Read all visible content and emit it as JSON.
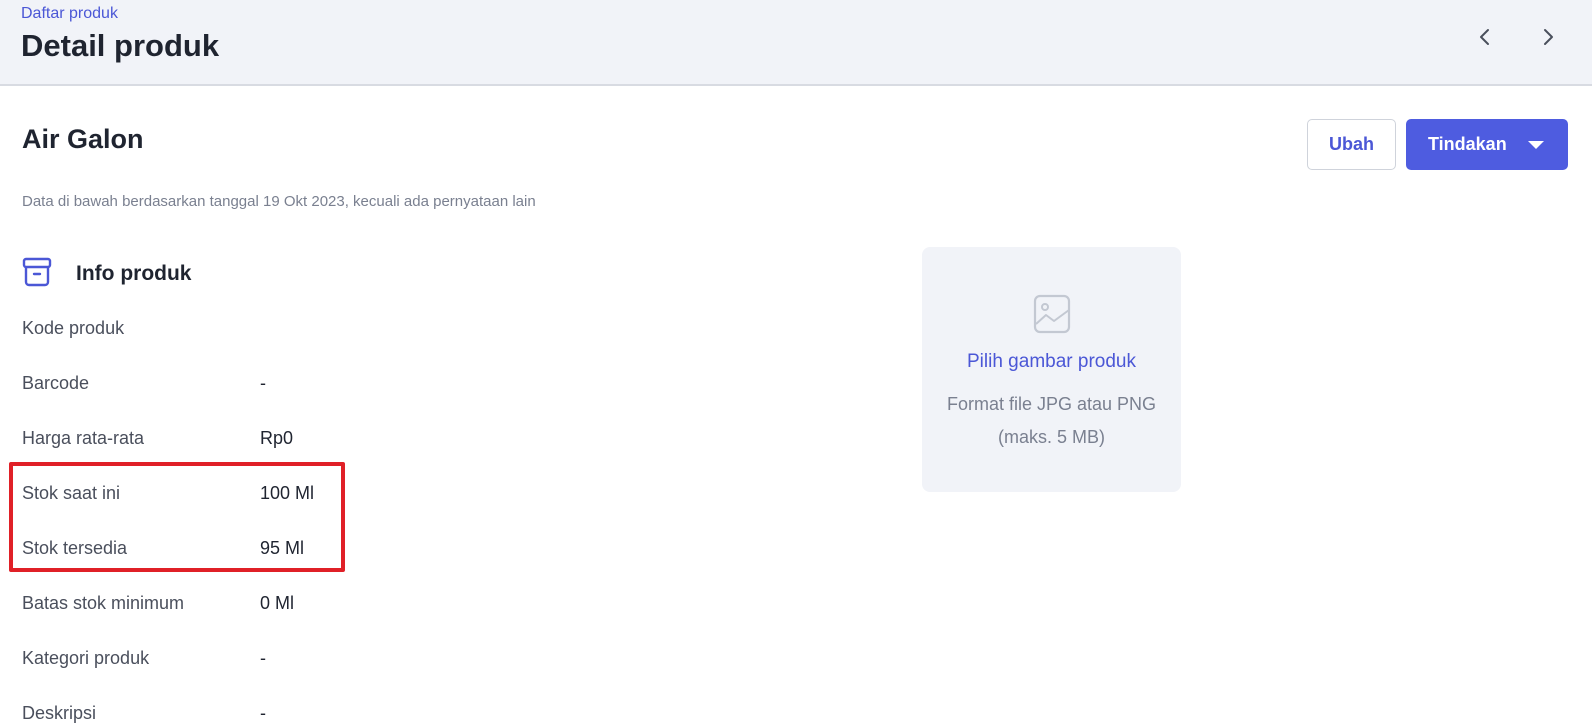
{
  "header": {
    "breadcrumb": "Daftar produk",
    "title": "Detail produk"
  },
  "product": {
    "name": "Air Galon",
    "edit_label": "Ubah",
    "actions_label": "Tindakan",
    "data_note": "Data di bawah berdasarkan tanggal 19 Okt 2023, kecuali ada pernyataan lain"
  },
  "info": {
    "section_title": "Info produk",
    "rows": [
      {
        "label": "Kode produk",
        "value": ""
      },
      {
        "label": "Barcode",
        "value": "-"
      },
      {
        "label": "Harga rata-rata",
        "value": "Rp0"
      },
      {
        "label": "Stok saat ini",
        "value": "100 Ml"
      },
      {
        "label": "Stok tersedia",
        "value": "95 Ml"
      },
      {
        "label": "Batas stok minimum",
        "value": "0 Ml"
      },
      {
        "label": "Kategori produk",
        "value": "-"
      },
      {
        "label": "Deskripsi",
        "value": "-"
      }
    ]
  },
  "image_picker": {
    "link": "Pilih gambar produk",
    "hint": "Format file JPG atau PNG (maks. 5 MB)"
  },
  "colors": {
    "accent": "#4e5ce0",
    "highlight": "#e02027"
  }
}
